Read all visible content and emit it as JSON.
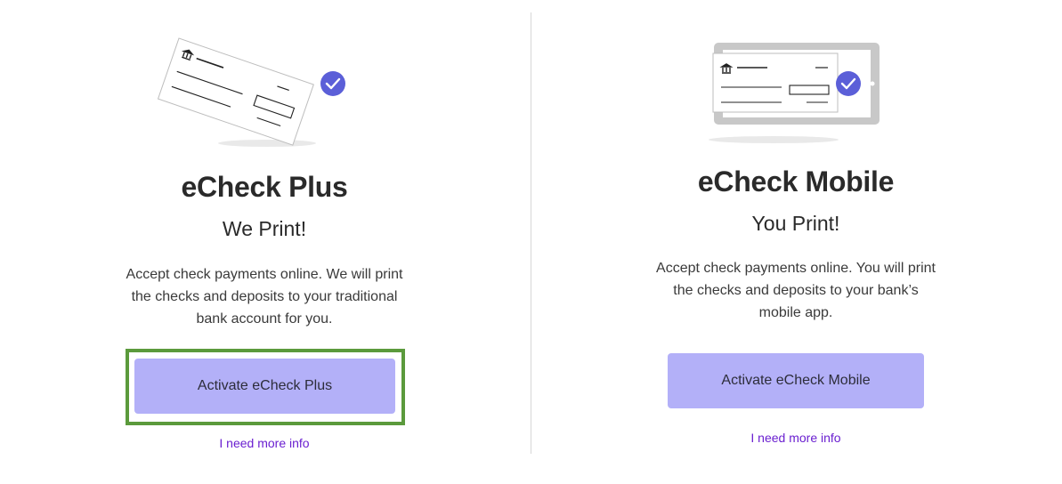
{
  "plus": {
    "title": "eCheck Plus",
    "subtitle": "We Print!",
    "description": "Accept check payments online. We will print the checks and deposits to your traditional bank account for you.",
    "button_label": "Activate eCheck Plus",
    "link_label": "I need more info"
  },
  "mobile": {
    "title": "eCheck Mobile",
    "subtitle": "You Print!",
    "description": "Accept check payments online. You will print the checks and deposits to your bank’s mobile app.",
    "button_label": "Activate eCheck Mobile",
    "link_label": "I need more info"
  },
  "colors": {
    "button_bg": "#b3b0f8",
    "check_badge": "#5b5fd8",
    "link": "#6a1fd0",
    "focus_outline": "#5b9a3c"
  },
  "icons": {
    "plus_illustration": "tilted-check-icon",
    "mobile_illustration": "tablet-check-icon",
    "badge": "checkmark-badge-icon"
  }
}
